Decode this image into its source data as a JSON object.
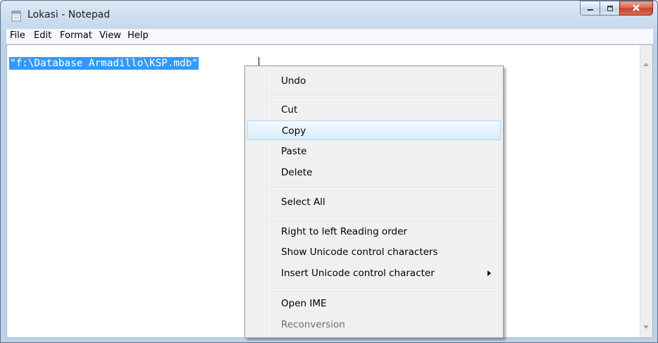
{
  "window": {
    "title": "Lokasi - Notepad"
  },
  "menubar": {
    "items": [
      "File",
      "Edit",
      "Format",
      "View",
      "Help"
    ]
  },
  "editor": {
    "text": "\"f:\\Database Armadillo\\KSP.mdb\""
  },
  "context_menu": {
    "items": [
      {
        "label": "Undo",
        "state": "normal"
      },
      {
        "label": "Cut",
        "state": "normal"
      },
      {
        "label": "Copy",
        "state": "hover"
      },
      {
        "label": "Paste",
        "state": "normal"
      },
      {
        "label": "Delete",
        "state": "normal"
      },
      {
        "label": "Select All",
        "state": "normal"
      },
      {
        "label": "Right to left Reading order",
        "state": "normal"
      },
      {
        "label": "Show Unicode control characters",
        "state": "normal"
      },
      {
        "label": "Insert Unicode control character",
        "state": "submenu"
      },
      {
        "label": "Open IME",
        "state": "normal"
      },
      {
        "label": "Reconversion",
        "state": "disabled"
      }
    ]
  },
  "colors": {
    "selection": "#3399ff",
    "menu_hover_border": "#a8d8f8",
    "disabled_text": "#6d6d6d",
    "close_button": "#c8432b"
  },
  "icons": {
    "app": "notepad-icon",
    "minimize": "minimize-icon",
    "maximize": "maximize-icon",
    "close": "close-icon",
    "submenu": "chevron-right-icon",
    "scroll_up": "arrow-up-icon",
    "scroll_down": "arrow-down-icon"
  }
}
